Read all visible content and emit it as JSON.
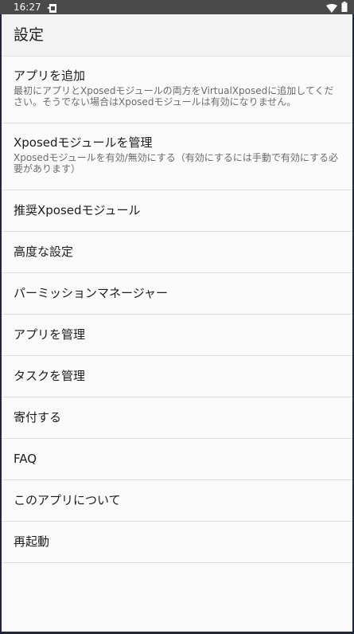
{
  "status_bar": {
    "time": "16:27",
    "icons": [
      "sim-icon",
      "wifi-icon",
      "battery-icon"
    ]
  },
  "app_bar": {
    "title": "設定"
  },
  "menu": {
    "items": [
      {
        "title": "アプリを追加",
        "summary": "最初にアプリとXposedモジュールの両方をVirtualXposedに追加してください。そうでない場合はXposedモジュールは有効になりません。"
      },
      {
        "title": "Xposedモジュールを管理",
        "summary": "Xposedモジュールを有効/無効にする（有効にするには手動で有効にする必要があります）"
      },
      {
        "title": "推奨Xposedモジュール"
      },
      {
        "title": "高度な設定"
      },
      {
        "title": "パーミッションマネージャー"
      },
      {
        "title": "アプリを管理"
      },
      {
        "title": "タスクを管理"
      },
      {
        "title": "寄付する"
      },
      {
        "title": "FAQ"
      },
      {
        "title": "このアプリについて"
      },
      {
        "title": "再起動"
      }
    ]
  },
  "colors": {
    "status_bar": "#4a4a4a",
    "app_bar": "#f3f3f3",
    "background": "#fafafa",
    "divider": "#dcdcdc",
    "frame": "#1f2440"
  }
}
